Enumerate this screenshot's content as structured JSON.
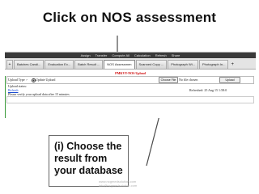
{
  "slide": {
    "title": "Click on NOS assessment",
    "callout": "(i) Choose the result from your database",
    "watermark": {
      "line1": "www.ncgmedsolution.com",
      "line2": "info@ncgmedsolution.com"
    }
  },
  "screenshot": {
    "top_menu": [
      "Assign",
      "Transfer",
      "Compute All",
      "Calculation",
      "Refresh",
      "Share"
    ],
    "tabs": [
      {
        "label": "+"
      },
      {
        "label": "Batches Candi..."
      },
      {
        "label": "Evaluation Ex..."
      },
      {
        "label": "Batch Result ..."
      },
      {
        "label": "NOS Assessmen"
      },
      {
        "label": "Scanned Copy ..."
      },
      {
        "label": "Photograph Wi..."
      },
      {
        "label": "Photograph In..."
      },
      {
        "label": "+"
      }
    ],
    "panel_title": "PMKVY-NOS Upload",
    "upload_type_label": "Upload Type :-",
    "upload_option": "Update Upload",
    "choose_file_button": "Choose File",
    "no_file_text": "No file chosen",
    "upload_button": "Upload",
    "upload_status_label": "Upload status:",
    "refresh_link": "Refresh",
    "refreshed_text": "Refreshed: 25 Aug 15 1:58:0",
    "info_message": "Please verify your upload data after 15 minutes"
  }
}
